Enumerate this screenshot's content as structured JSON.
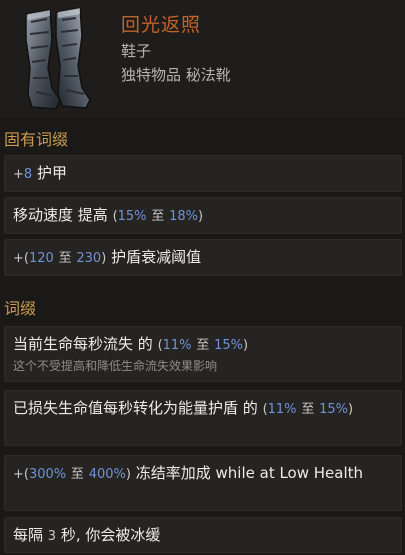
{
  "item": {
    "name": "回光返照",
    "base_type": "鞋子",
    "category": "独特物品 秘法靴",
    "icon": "arcane-boots-icon",
    "name_color": "#c0622b"
  },
  "implicit": {
    "title": "固有词缀",
    "mods": [
      {
        "plus": "+",
        "value": "8",
        "text": "护甲"
      },
      {
        "text": "移动速度 提高",
        "open": "(",
        "min": "15%",
        "sep": "至",
        "max": "18%",
        "close": ")"
      },
      {
        "plus": "+(",
        "min": "120",
        "sep": "至",
        "max": "230",
        "close": ")",
        "text": "护盾衰减阈值"
      }
    ]
  },
  "explicit": {
    "title": "词缀",
    "mods": [
      {
        "text": "当前生命每秒流失 的",
        "open": "(",
        "min": "11%",
        "sep": "至",
        "max": "15%",
        "close": ")",
        "note": "这个不受提高和降低生命流失效果影响"
      },
      {
        "text": "已损失生命值每秒转化为能量护盾 的",
        "open": "(",
        "min": "11%",
        "sep": "至",
        "max": "15%",
        "close": ")"
      },
      {
        "plus": "+(",
        "min": "300%",
        "sep": "至",
        "max": "400%",
        "close": ")",
        "text": "冻结率加成 while at Low Health"
      },
      {
        "text_a": "每隔",
        "num": "3",
        "text_b": "秒, 你会被冰缓"
      }
    ]
  },
  "colors": {
    "value_blue": "#6f93d6",
    "section_gold": "#c99a52"
  }
}
